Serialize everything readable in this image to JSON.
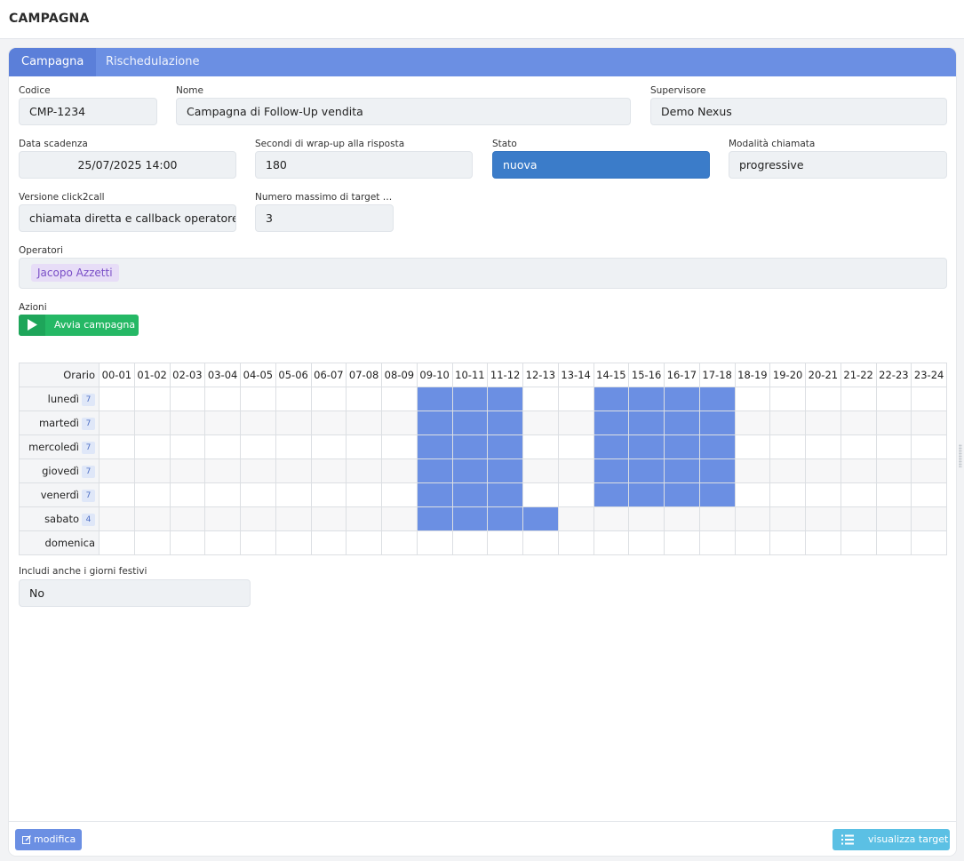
{
  "page": {
    "title": "CAMPAGNA"
  },
  "tabs": [
    {
      "label": "Campagna",
      "active": true
    },
    {
      "label": "Rischedulazione",
      "active": false
    }
  ],
  "form": {
    "codice": {
      "label": "Codice",
      "value": "CMP-1234"
    },
    "nome": {
      "label": "Nome",
      "value": "Campagna di Follow-Up vendita"
    },
    "supervisore": {
      "label": "Supervisore",
      "value": "Demo Nexus"
    },
    "data_scadenza": {
      "label": "Data scadenza",
      "value": "25/07/2025 14:00"
    },
    "wrapup": {
      "label": "Secondi di wrap-up alla risposta",
      "value": "180"
    },
    "stato": {
      "label": "Stato",
      "value": "nuova"
    },
    "modalita": {
      "label": "Modalità chiamata",
      "value": "progressive"
    },
    "click2call": {
      "label": "Versione click2call",
      "value": "chiamata diretta e callback operatore"
    },
    "max_target": {
      "label": "Numero massimo di target pe...",
      "value": "3"
    },
    "operatori": {
      "label": "Operatori",
      "items": [
        "Jacopo Azzetti"
      ]
    },
    "festivi": {
      "label": "Includi anche i giorni festivi",
      "value": "No"
    }
  },
  "actions": {
    "label": "Azioni",
    "start_label": "Avvia campagna"
  },
  "schedule": {
    "corner_label": "Orario",
    "hours": [
      "00-01",
      "01-02",
      "02-03",
      "03-04",
      "04-05",
      "05-06",
      "06-07",
      "07-08",
      "08-09",
      "09-10",
      "10-11",
      "11-12",
      "12-13",
      "13-14",
      "14-15",
      "15-16",
      "16-17",
      "17-18",
      "18-19",
      "19-20",
      "20-21",
      "21-22",
      "22-23",
      "23-24"
    ],
    "days": [
      {
        "name": "lunedì",
        "count": "7",
        "active_hours": [
          9,
          10,
          11,
          14,
          15,
          16,
          17
        ]
      },
      {
        "name": "martedì",
        "count": "7",
        "active_hours": [
          9,
          10,
          11,
          14,
          15,
          16,
          17
        ]
      },
      {
        "name": "mercoledì",
        "count": "7",
        "active_hours": [
          9,
          10,
          11,
          14,
          15,
          16,
          17
        ]
      },
      {
        "name": "giovedì",
        "count": "7",
        "active_hours": [
          9,
          10,
          11,
          14,
          15,
          16,
          17
        ]
      },
      {
        "name": "venerdì",
        "count": "7",
        "active_hours": [
          9,
          10,
          11,
          14,
          15,
          16,
          17
        ]
      },
      {
        "name": "sabato",
        "count": "4",
        "active_hours": [
          9,
          10,
          11,
          12
        ]
      },
      {
        "name": "domenica",
        "count": "",
        "active_hours": []
      }
    ]
  },
  "footer": {
    "edit_label": "modifica",
    "targets_label": "visualizza target"
  },
  "colors": {
    "accent": "#6b8fe3",
    "active_slot": "#6b8fe3",
    "stato": "#3b7cc9",
    "start": "#25b865",
    "targets": "#5bc0e4"
  }
}
